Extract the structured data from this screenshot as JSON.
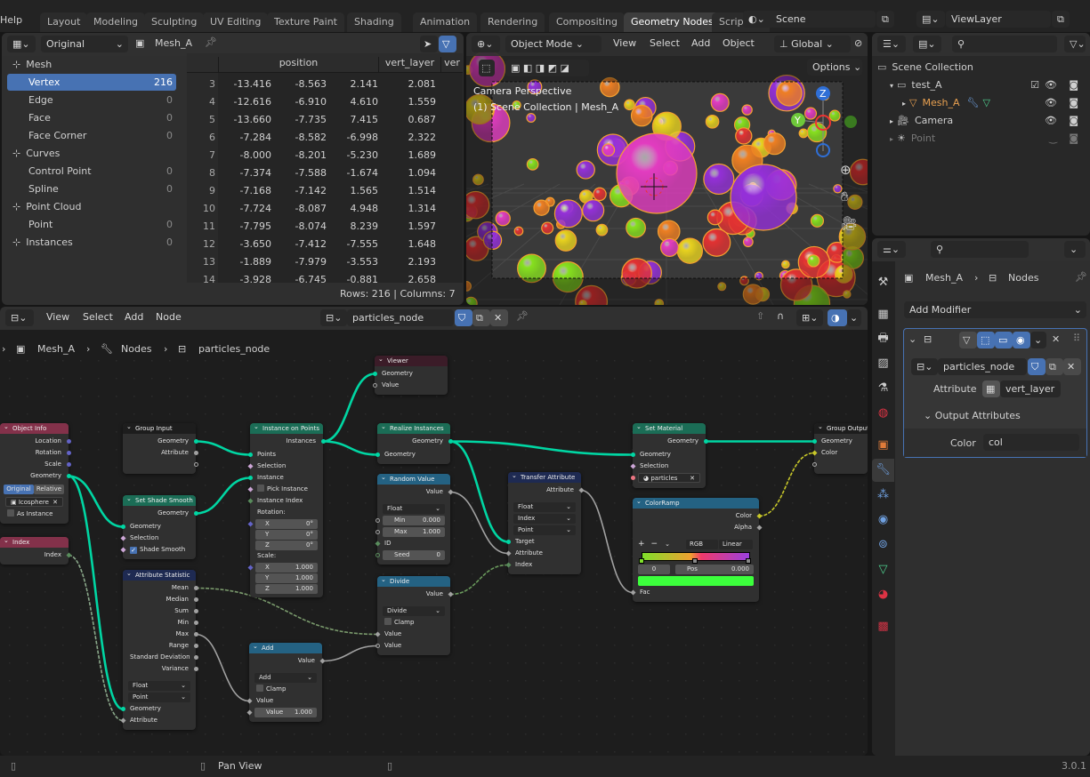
{
  "topbar": {
    "help": "Help",
    "tabs": [
      "Layout",
      "Modeling",
      "Sculpting",
      "UV Editing",
      "Texture Paint",
      "Shading",
      "Animation",
      "Rendering",
      "Compositing",
      "Geometry Nodes",
      "Scripting"
    ],
    "active_tab": "Geometry Nodes",
    "scene": "Scene",
    "view_layer": "ViewLayer"
  },
  "spreadsheet": {
    "mode": "Original",
    "object": "Mesh_A",
    "domains": [
      {
        "label": "Mesh",
        "header": true,
        "icon": "mesh-icon"
      },
      {
        "label": "Vertex",
        "count": "216",
        "selected": true
      },
      {
        "label": "Edge",
        "count": "0"
      },
      {
        "label": "Face",
        "count": "0"
      },
      {
        "label": "Face Corner",
        "count": "0"
      },
      {
        "label": "Curves",
        "header": true,
        "icon": "curve-icon"
      },
      {
        "label": "Control Point",
        "count": "0"
      },
      {
        "label": "Spline",
        "count": "0"
      },
      {
        "label": "Point Cloud",
        "header": true,
        "icon": "pointcloud-icon"
      },
      {
        "label": "Point",
        "count": "0"
      },
      {
        "label": "Instances",
        "header": true,
        "count": "0",
        "icon": "instances-icon"
      }
    ],
    "columns": [
      "position",
      "vert_layer",
      "ver"
    ],
    "rows": [
      [
        "3",
        "-13.416",
        "-8.563",
        "2.141",
        "2.081"
      ],
      [
        "4",
        "-12.616",
        "-6.910",
        "4.610",
        "1.559"
      ],
      [
        "5",
        "-13.660",
        "-7.735",
        "7.415",
        "0.687"
      ],
      [
        "6",
        "-7.284",
        "-8.582",
        "-6.998",
        "2.322"
      ],
      [
        "7",
        "-8.000",
        "-8.201",
        "-5.230",
        "1.689"
      ],
      [
        "8",
        "-7.374",
        "-7.588",
        "-1.674",
        "1.094"
      ],
      [
        "9",
        "-7.168",
        "-7.142",
        "1.565",
        "1.514"
      ],
      [
        "10",
        "-7.724",
        "-8.087",
        "4.948",
        "1.314"
      ],
      [
        "11",
        "-7.795",
        "-8.074",
        "8.239",
        "1.597"
      ],
      [
        "12",
        "-3.650",
        "-7.412",
        "-7.555",
        "1.648"
      ],
      [
        "13",
        "-1.889",
        "-7.979",
        "-3.553",
        "2.193"
      ],
      [
        "14",
        "-3.928",
        "-6.745",
        "-0.881",
        "2.658"
      ]
    ],
    "footer": "Rows: 216   |   Columns: 7"
  },
  "viewport": {
    "mode": "Object Mode",
    "menus": [
      "View",
      "Select",
      "Add",
      "Object"
    ],
    "orientation": "Global",
    "options": "Options",
    "overlay_title": "Camera Perspective",
    "overlay_sub": "(1) Scene Collection | Mesh_A",
    "gizmo_axes": [
      "Z",
      "Y"
    ],
    "colors": [
      "#e23cc0",
      "#e8d21e",
      "#86e01e",
      "#9430d8",
      "#ee7f22",
      "#e23232"
    ]
  },
  "outliner": {
    "items": [
      {
        "label": "Scene Collection",
        "depth": 0
      },
      {
        "label": "test_A",
        "depth": 1
      },
      {
        "label": "Mesh_A",
        "depth": 2,
        "color": "#e8a050"
      },
      {
        "label": "Camera",
        "depth": 1
      },
      {
        "label": "Point",
        "depth": 1,
        "dim": true
      }
    ]
  },
  "properties": {
    "breadcrumb": [
      "Mesh_A",
      "Nodes"
    ],
    "add_modifier": "Add Modifier",
    "node_group": "particles_node",
    "attribute_label": "Attribute",
    "attribute_value": "vert_layer",
    "output_attributes": "Output Attributes",
    "color_label": "Color",
    "color_value": "col"
  },
  "node_editor": {
    "menus": [
      "View",
      "Select",
      "Add",
      "Node"
    ],
    "node_group": "particles_node",
    "breadcrumb": [
      "Mesh_A",
      "Nodes",
      "particles_node"
    ],
    "nodes": [
      {
        "id": "objinfo",
        "title": "Object Info",
        "color": "#83314a",
        "rows": [
          {
            "t": "out",
            "label": "Location",
            "sock": "#6363c7"
          },
          {
            "t": "out",
            "label": "Rotation",
            "sock": "#6363c7"
          },
          {
            "t": "out",
            "label": "Scale",
            "sock": "#6363c7"
          },
          {
            "t": "out",
            "label": "Geometry",
            "sock": "#00d6a3"
          },
          {
            "t": "toggle2",
            "options": [
              "Original",
              "Relative"
            ]
          },
          {
            "t": "obj",
            "value": "Icosphere"
          },
          {
            "t": "check",
            "label": "As Instance"
          }
        ]
      },
      {
        "id": "index",
        "title": "Index",
        "color": "#83314a",
        "rows": [
          {
            "t": "out",
            "label": "Index",
            "sock": "#598c5c",
            "dia": true
          }
        ]
      },
      {
        "id": "groupin",
        "title": "Group Input",
        "color": "#1d1d1d",
        "rows": [
          {
            "t": "out",
            "label": "Geometry",
            "sock": "#00d6a3"
          },
          {
            "t": "out",
            "label": "Attribute",
            "sock": "#a1a1a1"
          },
          {
            "t": "out",
            "label": "",
            "sock": "#303030",
            "hollow": true
          }
        ]
      },
      {
        "id": "shade",
        "title": "Set Shade Smooth",
        "color": "#1b6d56",
        "rows": [
          {
            "t": "out",
            "label": "Geometry",
            "sock": "#00d6a3"
          },
          {
            "t": "in",
            "label": "Geometry",
            "sock": "#00d6a3"
          },
          {
            "t": "in",
            "label": "Selection",
            "sock": "#cca6d6",
            "dia": true
          },
          {
            "t": "check",
            "label": "Shade Smooth",
            "checked": true,
            "sock": "#cca6d6",
            "dia": true
          }
        ]
      },
      {
        "id": "stat",
        "title": "Attribute Statistic",
        "color": "#1e2a52",
        "rows": [
          {
            "t": "out",
            "label": "Mean",
            "sock": "#a1a1a1"
          },
          {
            "t": "out",
            "label": "Median",
            "sock": "#a1a1a1"
          },
          {
            "t": "out",
            "label": "Sum",
            "sock": "#a1a1a1"
          },
          {
            "t": "out",
            "label": "Min",
            "sock": "#a1a1a1"
          },
          {
            "t": "out",
            "label": "Max",
            "sock": "#a1a1a1"
          },
          {
            "t": "out",
            "label": "Range",
            "sock": "#a1a1a1"
          },
          {
            "t": "out",
            "label": "Standard Deviation",
            "sock": "#a1a1a1"
          },
          {
            "t": "out",
            "label": "Variance",
            "sock": "#a1a1a1"
          },
          {
            "t": "gap"
          },
          {
            "t": "dd",
            "value": "Float"
          },
          {
            "t": "dd",
            "value": "Point"
          },
          {
            "t": "in",
            "label": "Geometry",
            "sock": "#00d6a3"
          },
          {
            "t": "in",
            "label": "Attribute",
            "sock": "#a1a1a1",
            "dia": true
          }
        ]
      },
      {
        "id": "iop",
        "title": "Instance on Points",
        "color": "#1b6d56",
        "rows": [
          {
            "t": "out",
            "label": "Instances",
            "sock": "#00d6a3"
          },
          {
            "t": "in",
            "label": "Points",
            "sock": "#00d6a3"
          },
          {
            "t": "in",
            "label": "Selection",
            "sock": "#cca6d6",
            "dia": true
          },
          {
            "t": "in",
            "label": "Instance",
            "sock": "#00d6a3"
          },
          {
            "t": "check",
            "label": "Pick Instance",
            "sock": "#cca6d6",
            "dia": true
          },
          {
            "t": "in",
            "label": "Instance Index",
            "sock": "#598c5c",
            "dia": true
          },
          {
            "t": "label",
            "label": "Rotation:"
          },
          {
            "t": "vec",
            "label": "X",
            "value": "0°",
            "sock": "#6363c7",
            "dia": true
          },
          {
            "t": "vec",
            "label": "Y",
            "value": "0°"
          },
          {
            "t": "vec",
            "label": "Z",
            "value": "0°"
          },
          {
            "t": "label",
            "label": "Scale:"
          },
          {
            "t": "vec",
            "label": "X",
            "value": "1.000",
            "sock": "#6363c7",
            "dia": true
          },
          {
            "t": "vec",
            "label": "Y",
            "value": "1.000"
          },
          {
            "t": "vec",
            "label": "Z",
            "value": "1.000"
          }
        ]
      },
      {
        "id": "add",
        "title": "Add",
        "color": "#246283",
        "rows": [
          {
            "t": "out",
            "label": "Value",
            "sock": "#a1a1a1",
            "dia": true
          },
          {
            "t": "gap"
          },
          {
            "t": "dd",
            "value": "Add"
          },
          {
            "t": "check",
            "label": "Clamp"
          },
          {
            "t": "in",
            "label": "Value",
            "sock": "#a1a1a1",
            "dia": true
          },
          {
            "t": "field",
            "label": "Value",
            "value": "1.000",
            "sock": "#a1a1a1",
            "dia": true
          }
        ]
      },
      {
        "id": "viewer",
        "title": "Viewer",
        "color": "#3b1c28",
        "rows": [
          {
            "t": "in",
            "label": "Geometry",
            "sock": "#00d6a3"
          },
          {
            "t": "in",
            "label": "Value",
            "sock": "#a1a1a1",
            "hollow": true
          }
        ]
      },
      {
        "id": "realize",
        "title": "Realize Instances",
        "color": "#1b6d56",
        "rows": [
          {
            "t": "out",
            "label": "Geometry",
            "sock": "#00d6a3"
          },
          {
            "t": "in",
            "label": "Geometry",
            "sock": "#00d6a3"
          }
        ]
      },
      {
        "id": "random",
        "title": "Random Value",
        "color": "#246283",
        "rows": [
          {
            "t": "out",
            "label": "Value",
            "sock": "#a1a1a1",
            "dia": true
          },
          {
            "t": "gap"
          },
          {
            "t": "dd",
            "value": "Float"
          },
          {
            "t": "field",
            "label": "Min",
            "value": "0.000",
            "sock": "#a1a1a1",
            "hollow": true
          },
          {
            "t": "field",
            "label": "Max",
            "value": "1.000",
            "sock": "#a1a1a1",
            "hollow": true
          },
          {
            "t": "in",
            "label": "ID",
            "sock": "#598c5c",
            "dia": true
          },
          {
            "t": "field",
            "label": "Seed",
            "value": "0",
            "sock": "#598c5c",
            "hollow": true
          }
        ]
      },
      {
        "id": "divide",
        "title": "Divide",
        "color": "#246283",
        "rows": [
          {
            "t": "out",
            "label": "Value",
            "sock": "#a1a1a1",
            "dia": true
          },
          {
            "t": "gap"
          },
          {
            "t": "dd",
            "value": "Divide"
          },
          {
            "t": "check",
            "label": "Clamp"
          },
          {
            "t": "in",
            "label": "Value",
            "sock": "#a1a1a1",
            "dia": true
          },
          {
            "t": "in",
            "label": "Value",
            "sock": "#a1a1a1",
            "hollow": true
          }
        ]
      },
      {
        "id": "transfer",
        "title": "Transfer Attribute",
        "color": "#1e2a52",
        "rows": [
          {
            "t": "out",
            "label": "Attribute",
            "sock": "#a1a1a1",
            "dia": true
          },
          {
            "t": "gap"
          },
          {
            "t": "dd",
            "value": "Float"
          },
          {
            "t": "dd",
            "value": "Index"
          },
          {
            "t": "dd",
            "value": "Point"
          },
          {
            "t": "in",
            "label": "Target",
            "sock": "#00d6a3"
          },
          {
            "t": "in",
            "label": "Attribute",
            "sock": "#a1a1a1",
            "dia": true
          },
          {
            "t": "in",
            "label": "Index",
            "sock": "#598c5c",
            "dia": true
          }
        ]
      },
      {
        "id": "setmat",
        "title": "Set Material",
        "color": "#1b6d56",
        "rows": [
          {
            "t": "out",
            "label": "Geometry",
            "sock": "#00d6a3"
          },
          {
            "t": "in",
            "label": "Geometry",
            "sock": "#00d6a3"
          },
          {
            "t": "in",
            "label": "Selection",
            "sock": "#cca6d6",
            "dia": true
          },
          {
            "t": "obj",
            "value": "particles",
            "sock": "#eb7582",
            "icon": "material"
          }
        ]
      },
      {
        "id": "ramp",
        "title": "ColorRamp",
        "color": "#246283",
        "rows": [
          {
            "t": "out",
            "label": "Color",
            "sock": "#c7c729",
            "dia": true
          },
          {
            "t": "out",
            "label": "Alpha",
            "sock": "#a1a1a1",
            "dia": true
          },
          {
            "t": "gap"
          },
          {
            "t": "rampctl",
            "mode": "RGB",
            "interp": "Linear"
          },
          {
            "t": "rampbar"
          },
          {
            "t": "ramppos",
            "index": "0",
            "label": "Pos",
            "value": "0.000"
          },
          {
            "t": "swatch",
            "color": "#3cff3c"
          },
          {
            "t": "in",
            "label": "Fac",
            "sock": "#a1a1a1",
            "dia": true
          }
        ]
      },
      {
        "id": "groupout",
        "title": "Group Output",
        "color": "#1d1d1d",
        "rows": [
          {
            "t": "in",
            "label": "Geometry",
            "sock": "#00d6a3"
          },
          {
            "t": "in",
            "label": "Color",
            "sock": "#c7c729",
            "dia": true
          },
          {
            "t": "in",
            "label": "",
            "sock": "#303030",
            "hollow": true
          }
        ]
      }
    ],
    "links": [
      {
        "from": "groupin.0",
        "to": "iop.1",
        "color": "#00d6a3"
      },
      {
        "from": "objinfo.3",
        "to": "shade.1",
        "color": "#00d6a3"
      },
      {
        "from": "objinfo.3",
        "to": "stat.11",
        "color": "#00d6a3"
      },
      {
        "from": "shade.0",
        "to": "iop.3",
        "color": "#00d6a3"
      },
      {
        "from": "iop.0",
        "to": "viewer.0",
        "color": "#00d6a3"
      },
      {
        "from": "iop.0",
        "to": "realize.1",
        "color": "#00d6a3"
      },
      {
        "from": "realize.0",
        "to": "setmat.1",
        "color": "#00d6a3"
      },
      {
        "from": "realize.0",
        "to": "transfer.5",
        "color": "#00d6a3"
      },
      {
        "from": "setmat.0",
        "to": "groupout.0",
        "color": "#00d6a3"
      },
      {
        "from": "random.0",
        "to": "transfer.6",
        "color": "#a1a1a1"
      },
      {
        "from": "divide.0",
        "to": "transfer.7",
        "color": "#6a9a5c",
        "dashed": true
      },
      {
        "from": "transfer.0",
        "to": "ramp.7",
        "color": "#a1a1a1"
      },
      {
        "from": "ramp.0",
        "to": "groupout.1",
        "color": "#c7c729",
        "dashed": true
      },
      {
        "from": "index.0",
        "to": "stat.12",
        "color": "#8aa88a",
        "dashed": true
      },
      {
        "from": "stat.0",
        "to": "divide.4",
        "color": "#7a9a6c",
        "dashed": true
      },
      {
        "from": "stat.4",
        "to": "add.4",
        "color": "#a1a1a1"
      },
      {
        "from": "add.0",
        "to": "divide.5",
        "color": "#a1a1a1"
      }
    ]
  },
  "statusbar": {
    "left": "Pan View",
    "version": "3.0.1"
  }
}
